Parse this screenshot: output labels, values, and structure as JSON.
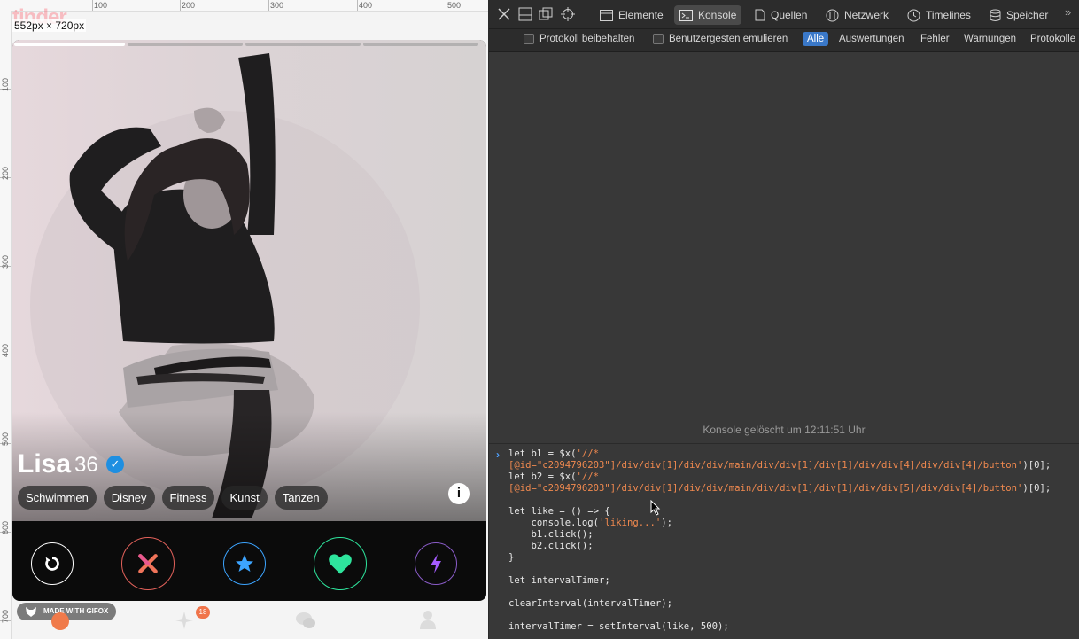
{
  "left_panel": {
    "logo_text": "tinder",
    "viewport_label": "552px × 720px",
    "ruler_h": [
      "100",
      "200",
      "300",
      "400",
      "500"
    ],
    "ruler_v": [
      "100",
      "200",
      "300",
      "400",
      "500",
      "600",
      "700"
    ],
    "profile": {
      "name": "Lisa",
      "age": "36",
      "photo_segments_active": 1,
      "photo_segments_total": 4,
      "interests": [
        "Schwimmen",
        "Disney",
        "Fitness",
        "Kunst",
        "Tanzen"
      ],
      "info_label": "i"
    },
    "actions": [
      {
        "name": "rewind",
        "icon": "rewind-icon",
        "color": "#ffffff"
      },
      {
        "name": "nope",
        "icon": "x-icon",
        "color": "#f15b5b"
      },
      {
        "name": "super-like",
        "icon": "star-icon",
        "color": "#3ca4ff"
      },
      {
        "name": "like",
        "icon": "heart-icon",
        "color": "#2ee59d"
      },
      {
        "name": "boost",
        "icon": "bolt-icon",
        "color": "#a55cff"
      }
    ],
    "gifox_label": "MADE WITH GIFOX",
    "nav_badge": "18"
  },
  "devtools": {
    "tabs": [
      "Elemente",
      "Konsole",
      "Quellen",
      "Netzwerk",
      "Timelines",
      "Speicher"
    ],
    "active_tab": "Konsole",
    "checkboxes": [
      "Protokoll beibehalten",
      "Benutzergesten emulieren"
    ],
    "filters": [
      "Alle",
      "Auswertungen",
      "Fehler",
      "Warnungen",
      "Protokolle"
    ],
    "active_filter": "Alle",
    "cleared_message": "Konsole gelöscht um 12:11:51 Uhr",
    "code": {
      "l1a": "let b1 = $x(",
      "l1s1": "'//*",
      "l1s2": "[@id=\"c2094796203\"]/div/div[1]/div/div/main/div/div[1]/div[1]/div/div[4]/div/div[4]/button'",
      "l1e": ")[0];",
      "l2a": "let b2 = $x(",
      "l2s1": "'//*",
      "l2s2": "[@id=\"c2094796203\"]/div/div[1]/div/div/main/div/div[1]/div[1]/div/div[5]/div/div[4]/button'",
      "l2e": ")[0];",
      "l3": "let like = () => {",
      "l4a": "    console.log(",
      "l4s": "'liking...'",
      "l4e": ");",
      "l5": "    b1.click();",
      "l6": "    b2.click();",
      "l7": "}",
      "l8": "let intervalTimer;",
      "l9": "clearInterval(intervalTimer);",
      "l10": "intervalTimer = setInterval(like, 500);"
    }
  }
}
